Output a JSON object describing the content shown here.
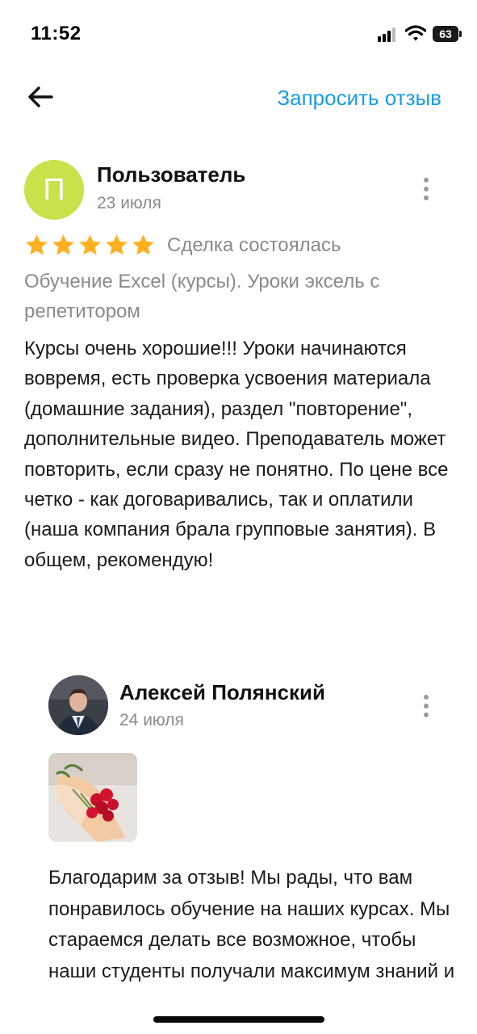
{
  "status_bar": {
    "time": "11:52",
    "battery": "63",
    "icons": [
      "signal-icon",
      "wifi-icon",
      "battery-icon"
    ]
  },
  "nav": {
    "back_icon": "arrow-left-icon",
    "request_review": "Запросить отзыв",
    "accent_color": "#1a9be8"
  },
  "review": {
    "avatar_letter": "П",
    "avatar_color": "#c9e14a",
    "author": "Пользователь",
    "date": "23 июля",
    "rating": 5,
    "star_color": "#ffb020",
    "deal_status": "Сделка состоялась",
    "service": "Обучение Excel (курсы). Уроки эксель с репетитором",
    "text": "Курсы очень хорошие!!! Уроки начинаются вовремя, есть проверка усвоения материала (домашние задания), раздел \"повторение\", дополнительные видео. Преподаватель может повторить, если сразу не понятно. По цене все четко - как договаривались, так и оплатили (наша компания брала групповые занятия). В общем, рекомендую!"
  },
  "reply": {
    "author": "Алексей Полянский",
    "date": "24 июля",
    "text": "Благодарим за отзыв! Мы рады, что вам понравилось обучение на наших курсах. Мы стараемся делать все возможное, чтобы наши студенты получали максимум знаний и"
  }
}
